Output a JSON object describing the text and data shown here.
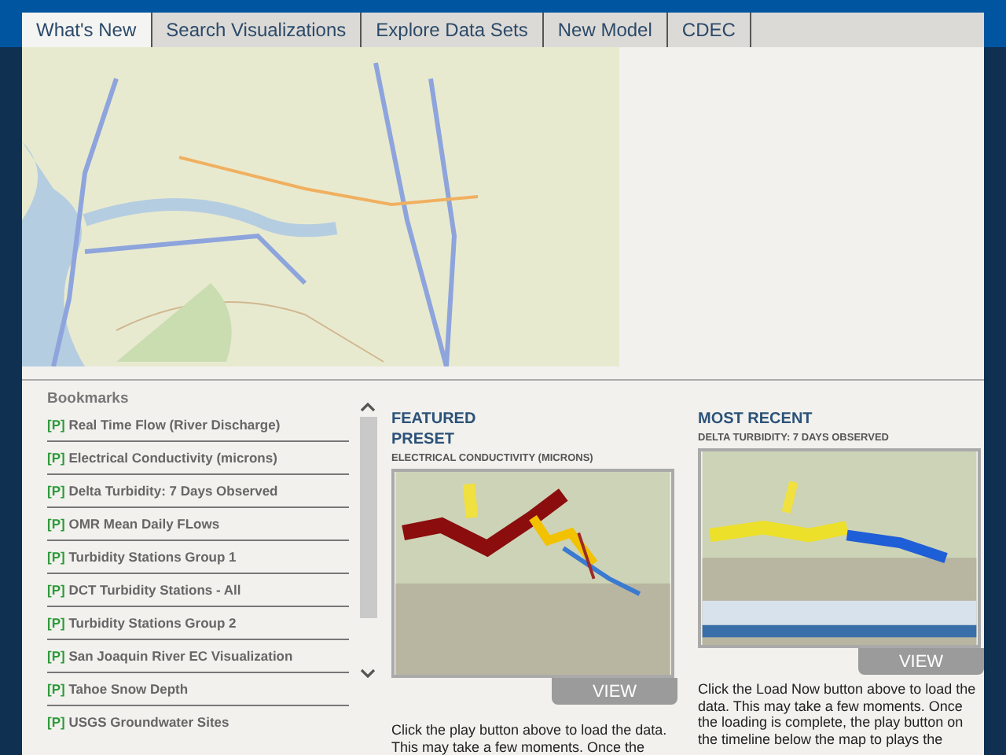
{
  "tabs": [
    {
      "label": "What's New",
      "selected": true
    },
    {
      "label": "Search Visualizations",
      "selected": false
    },
    {
      "label": "Explore Data Sets",
      "selected": false
    },
    {
      "label": "New Model",
      "selected": false
    },
    {
      "label": "CDEC",
      "selected": false
    }
  ],
  "bookmarks": {
    "title": "Bookmarks",
    "items": [
      {
        "prefix": "[P]",
        "label": "Real Time Flow (River Discharge)"
      },
      {
        "prefix": "[P]",
        "label": "Electrical Conductivity (microns)"
      },
      {
        "prefix": "[P]",
        "label": "Delta Turbidity: 7 Days Observed"
      },
      {
        "prefix": "[P]",
        "label": "OMR Mean Daily FLows"
      },
      {
        "prefix": "[P]",
        "label": "Turbidity Stations Group 1"
      },
      {
        "prefix": "[P]",
        "label": "DCT Turbidity Stations - All"
      },
      {
        "prefix": "[P]",
        "label": "Turbidity Stations Group 2"
      },
      {
        "prefix": "[P]",
        "label": "San Joaquin River EC Visualization"
      },
      {
        "prefix": "[P]",
        "label": "Tahoe Snow Depth"
      },
      {
        "prefix": "[P]",
        "label": "USGS Groundwater Sites"
      }
    ]
  },
  "cards": [
    {
      "kind": "featured",
      "heading": "FEATURED PRESET",
      "subtitle": "ELECTRICAL CONDUCTIVITY (MICRONS)",
      "button": "VIEW",
      "description": "Click the play button above to load the data. This may take a few moments. Once the"
    },
    {
      "kind": "recent",
      "heading": "MOST RECENT",
      "subtitle": "DELTA TURBIDITY: 7 DAYS OBSERVED",
      "button": "VIEW",
      "description": "Click the Load Now button above to load the data. This may take a few moments. Once the loading is complete, the play button on the timeline below the map to plays the"
    }
  ]
}
